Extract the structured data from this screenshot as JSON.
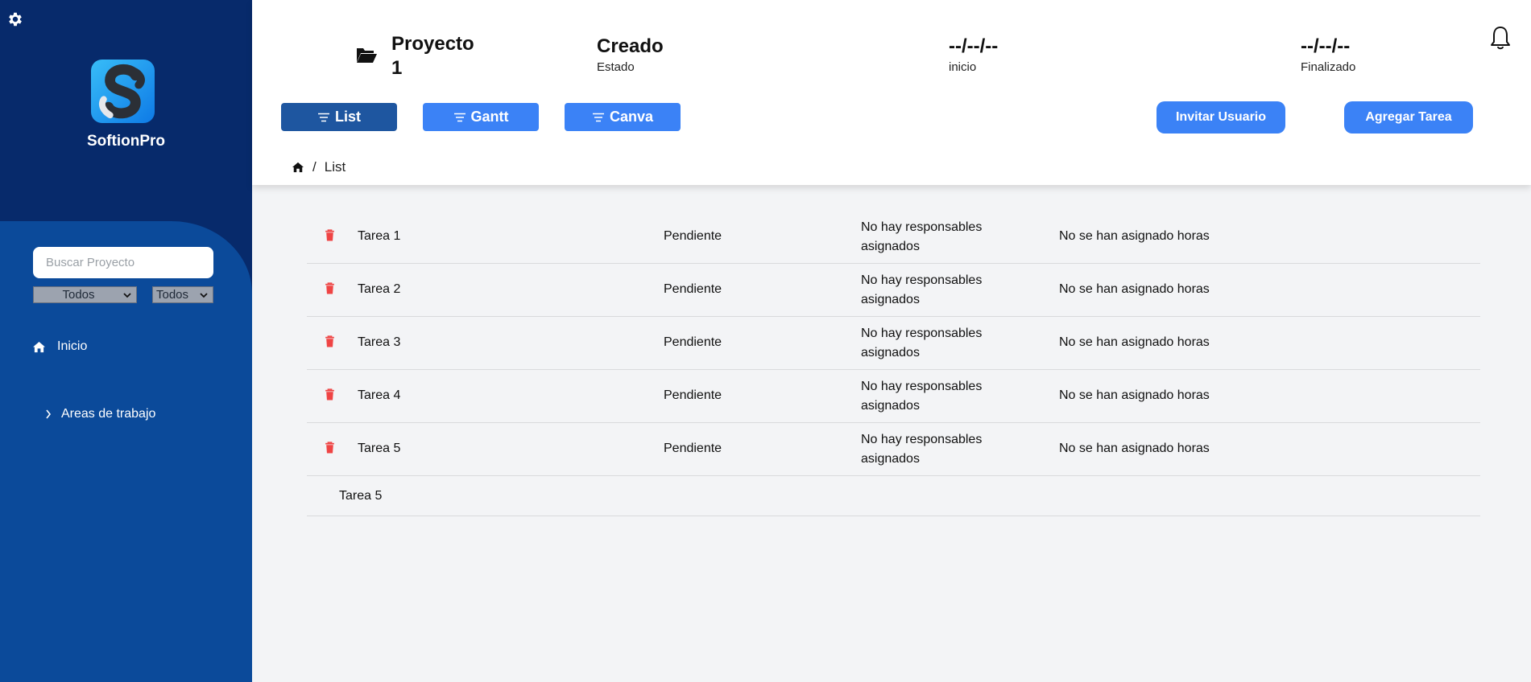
{
  "sidebar": {
    "brand": "SoftionPro",
    "search_placeholder": "Buscar Proyecto",
    "filter1": "Todos",
    "filter2": "Todos",
    "nav_inicio": "Inicio",
    "nav_areas": "Areas de trabajo"
  },
  "header": {
    "project_line1": "Proyecto",
    "project_line2": "1",
    "state_value": "Creado",
    "state_label": "Estado",
    "start_value": "--/--/--",
    "start_label": "inicio",
    "end_value": "--/--/--",
    "end_label": "Finalizado",
    "views": [
      "List",
      "Gantt",
      "Canva"
    ],
    "invite_label": "Invitar Usuario",
    "add_task_label": "Agregar Tarea",
    "breadcrumb_separator": "/",
    "breadcrumb_current": "List"
  },
  "tasks": [
    {
      "name": "Tarea 1",
      "status": "Pendiente",
      "responsables": "No hay responsables asignados",
      "hours": "No se han asignado horas"
    },
    {
      "name": "Tarea 2",
      "status": "Pendiente",
      "responsables": "No hay responsables asignados",
      "hours": "No se han asignado horas"
    },
    {
      "name": "Tarea 3",
      "status": "Pendiente",
      "responsables": "No hay responsables asignados",
      "hours": "No se han asignado horas"
    },
    {
      "name": "Tarea 4",
      "status": "Pendiente",
      "responsables": "No hay responsables asignados",
      "hours": "No se han asignado horas"
    },
    {
      "name": "Tarea 5",
      "status": "Pendiente",
      "responsables": "No hay responsables asignados",
      "hours": "No se han asignado horas"
    }
  ],
  "new_task_row": "Tarea 5",
  "colors": {
    "sidebar_top": "#072a6b",
    "sidebar_bottom": "#0b4a9a",
    "button_blue": "#3b82f6",
    "button_active": "#1e56a0",
    "delete_red": "#ef4444"
  },
  "icons": {
    "settings": "gear-icon",
    "folder": "folder-open-icon",
    "bell": "bell-icon",
    "home": "home-icon",
    "chevron": "chevron-right-icon",
    "search": "search-icon",
    "trash": "trash-icon",
    "list": "list-icon"
  }
}
